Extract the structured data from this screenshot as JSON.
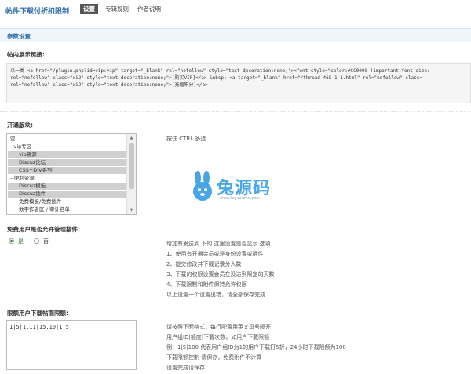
{
  "header": {
    "plugin_title": "帖件下载付折扣限制",
    "tabs": [
      {
        "label": "设置",
        "active": true
      },
      {
        "label": "专辑规则",
        "active": false
      },
      {
        "label": "作者说明",
        "active": false
      }
    ]
  },
  "section": {
    "title": "参数设置"
  },
  "code_field": {
    "label": "帖内展示链接:",
    "lines": [
      "以一类 <a href=\"/plugin.php?id=vip:vip\" target=\"_blank\" rel=\"nofollow\" style=\"text-decoration:none;\"><font style=\"color:#CC0000 !important;font-size:",
      "rel=\"nofollow\" class=\"xi2\" style=\"text-decoration:none;\">[购买VIP]</a> &nbsp; <a target=\"_blank\" href=\"/thread-465-1-1.html\" rel=\"nofollow\" class=",
      "rel=\"nofollow\" class=\"xi2\" style=\"text-decoration:none;\">[充值积分]</a>"
    ]
  },
  "forums_field": {
    "label": "开通版块:",
    "options": [
      {
        "label": "空",
        "selected": false
      },
      {
        "label": "--vip专区",
        "selected": false
      },
      {
        "label": "vip资源",
        "selected": true
      },
      {
        "label": "Discuz论坛",
        "selected": true
      },
      {
        "label": "CSS+DIV系列",
        "selected": true
      },
      {
        "label": "--便利资源",
        "selected": false
      },
      {
        "label": "Discuz模板",
        "selected": true
      },
      {
        "label": "Discuz插件",
        "selected": true
      },
      {
        "label": "免费模板/免费插件",
        "selected": false
      },
      {
        "label": "数字作者区 / 审计名单",
        "selected": false
      }
    ],
    "hint": "按住 CTRL 多选"
  },
  "watermark": {
    "text": "兔源码",
    "url": "www.tuyuanma.com"
  },
  "vip_plugin_field": {
    "label": "免费用户是否允许管理插件:",
    "options": [
      {
        "label": "是",
        "checked": true
      },
      {
        "label": "否",
        "checked": false
      }
    ],
    "hint_lines": [
      "增加有发送到 下的 这里设置是否显示 选项",
      "1、使用有开通会员或是身份设置或插件",
      "2、提交修改并下载记录分人数",
      "3、下载的权限设置会员在没达到限定的天数",
      "4、下载限制和附件保持允许权限",
      "以上设置一个设置出错，请全部保存完成"
    ]
  },
  "rate_field": {
    "label": "限额用户下载帖面限额:",
    "value": "1|5|1,11|15,10|1|5",
    "hint_lines": [
      "请按照下面格式，每行配置用英文逗号隔开",
      "用户组ID|额度|下载次数，如用户下载限额",
      "例：1|5|100 代表用户组ID为1的用户下载打5折，24小时下载限额为100",
      "下载限额控制 请保存，免费附件不计算",
      "设置完成请保存"
    ]
  }
}
